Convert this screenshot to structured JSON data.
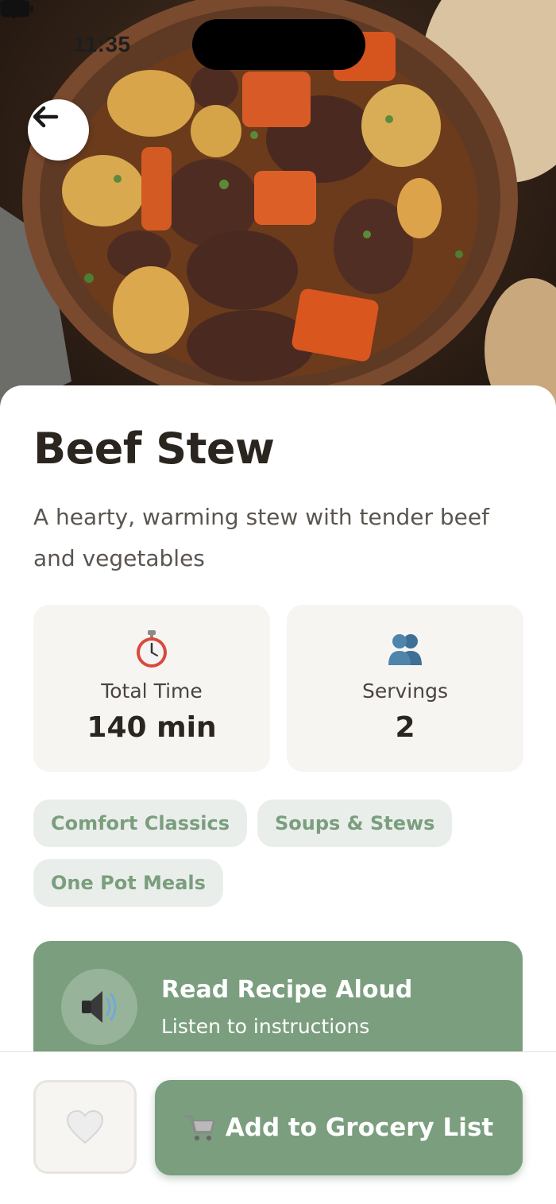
{
  "status_bar": {
    "time": "11:35"
  },
  "hero": {
    "image_description": "Bowl of beef stew with potatoes and carrots"
  },
  "recipe": {
    "title": "Beef Stew",
    "description": "A hearty, warming stew with tender beef and vegetables"
  },
  "stats": {
    "total_time": {
      "icon": "stopwatch-icon",
      "label": "Total Time",
      "value": "140 min"
    },
    "servings": {
      "icon": "people-icon",
      "label": "Servings",
      "value": "2"
    }
  },
  "tags": [
    "Comfort Classics",
    "Soups & Stews",
    "One Pot Meals"
  ],
  "read_aloud": {
    "icon": "speaker-icon",
    "title": "Read Recipe Aloud",
    "subtitle": "Listen to instructions"
  },
  "actions": {
    "favorite_icon": "heart-icon",
    "grocery_icon": "cart-icon",
    "grocery_label": "Add to Grocery List"
  },
  "colors": {
    "accent_green": "#7a9e7e",
    "tag_background": "#eaeeea",
    "card_background": "#f7f5f2",
    "title_text": "#2b2520"
  }
}
